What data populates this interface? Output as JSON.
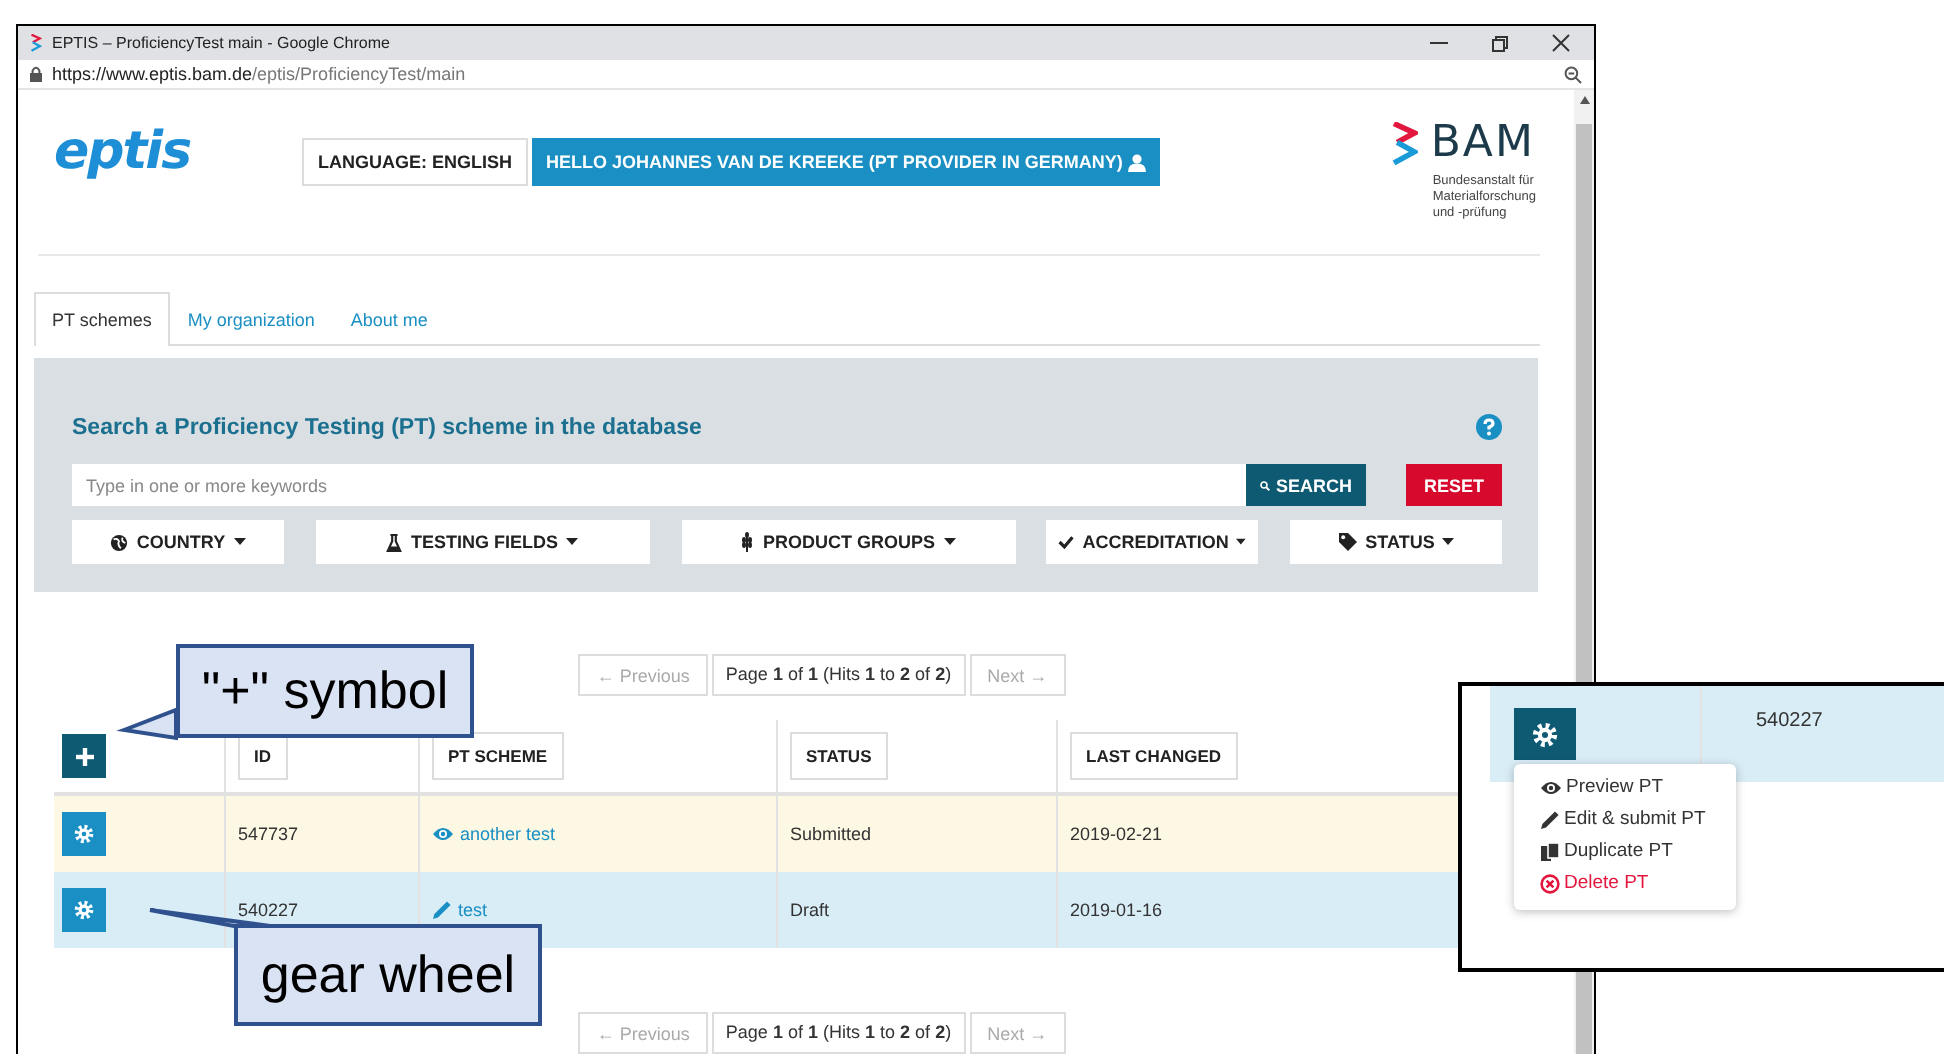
{
  "browser": {
    "title": "EPTIS – ProficiencyTest main - Google Chrome",
    "url_host": "https://www.eptis.bam.de",
    "url_path": "/eptis/ProficiencyTest/main"
  },
  "header": {
    "logo": "eptis",
    "language_button": "LANGUAGE: ENGLISH",
    "user_button": "HELLO JOHANNES VAN DE KREEKE (PT PROVIDER IN GERMANY)",
    "brand": "BAM",
    "brand_subtitle": [
      "Bundesanstalt für",
      "Materialforschung",
      "und -prüfung"
    ]
  },
  "tabs": [
    {
      "label": "PT schemes",
      "selected": true
    },
    {
      "label": "My organization",
      "selected": false
    },
    {
      "label": "About me",
      "selected": false
    }
  ],
  "search": {
    "title": "Search a Proficiency Testing (PT) scheme in the database",
    "placeholder": "Type in one or more keywords",
    "search_button": "SEARCH",
    "reset_button": "RESET",
    "filters": [
      {
        "label": "COUNTRY",
        "kind": "globe"
      },
      {
        "label": "TESTING FIELDS",
        "kind": "flask"
      },
      {
        "label": "PRODUCT GROUPS",
        "kind": "wheat"
      },
      {
        "label": "ACCREDITATION",
        "kind": "check"
      },
      {
        "label": "STATUS",
        "kind": "tag"
      }
    ]
  },
  "pagination": [
    {
      "previous": {
        "label": "← Previous",
        "disabled": true
      },
      "page": "Page **1** of **1** (Hits **1** to **2** of **2**)",
      "next": {
        "label": "Next →",
        "disabled": true
      }
    },
    {
      "previous": {
        "label": "← Previous",
        "disabled": true
      },
      "page": "Page **1** of **1** (Hits **1** to **2** of **2**)",
      "next": {
        "label": "Next →",
        "disabled": true
      }
    }
  ],
  "table": {
    "columns": [
      "ID",
      "PT SCHEME",
      "STATUS",
      "LAST CHANGED"
    ],
    "rows": [
      {
        "id": "547737",
        "scheme": "another test",
        "kind": "preview",
        "status": "Submitted",
        "last_changed": "2019-02-21",
        "color": "#fcf8e3"
      },
      {
        "id": "540227",
        "scheme": "test",
        "kind": "edit",
        "status": "Draft",
        "last_changed": "2019-01-16",
        "color": "#d9edf7"
      }
    ]
  },
  "callouts": [
    {
      "text": "\"+\" symbol",
      "kind": "add"
    },
    {
      "text": "gear wheel",
      "kind": "gear"
    }
  ],
  "inset": {
    "id": "540227",
    "menu": [
      {
        "label": "Preview PT",
        "kind": "preview"
      },
      {
        "label": "Edit & submit PT",
        "kind": "edit"
      },
      {
        "label": "Duplicate PT",
        "kind": "duplicate"
      },
      {
        "label": "Delete PT",
        "kind": "delete"
      }
    ]
  }
}
